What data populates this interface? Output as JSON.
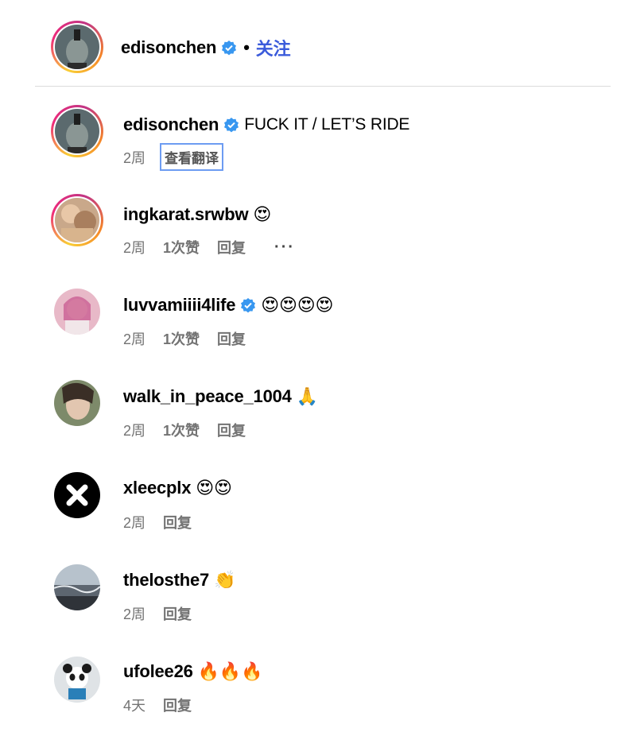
{
  "post_author": {
    "username": "edisonchen",
    "separator": "•",
    "follow_label": "关注"
  },
  "caption": {
    "username": "edisonchen",
    "text": "FUCK IT / LET’S RIDE",
    "time": "2周",
    "translate_label": "查看翻译"
  },
  "comments": [
    {
      "username": "ingkarat.srwbw",
      "emoji": "😍",
      "time": "2周",
      "likes": "1次赞",
      "reply": "回复",
      "more": "···"
    },
    {
      "username": "luvvamiiii4life",
      "emoji": "😍😍😍😍",
      "time": "2周",
      "likes": "1次赞",
      "reply": "回复"
    },
    {
      "username": "walk_in_peace_1004",
      "emoji": "🙏",
      "time": "2周",
      "likes": "1次赞",
      "reply": "回复"
    },
    {
      "username": "xleecplx",
      "emoji": "😍😍",
      "time": "2周",
      "reply": "回复"
    },
    {
      "username": "thelosthe7",
      "emoji": "👏",
      "time": "2周",
      "reply": "回复"
    },
    {
      "username": "ufolee26",
      "emoji": "🔥🔥🔥",
      "time": "4天",
      "reply": "回复"
    }
  ],
  "colors": {
    "follow": "#3b5bdb",
    "verified": "#3897f0",
    "meta": "#737373",
    "translate_border": "#6d9cf2"
  }
}
